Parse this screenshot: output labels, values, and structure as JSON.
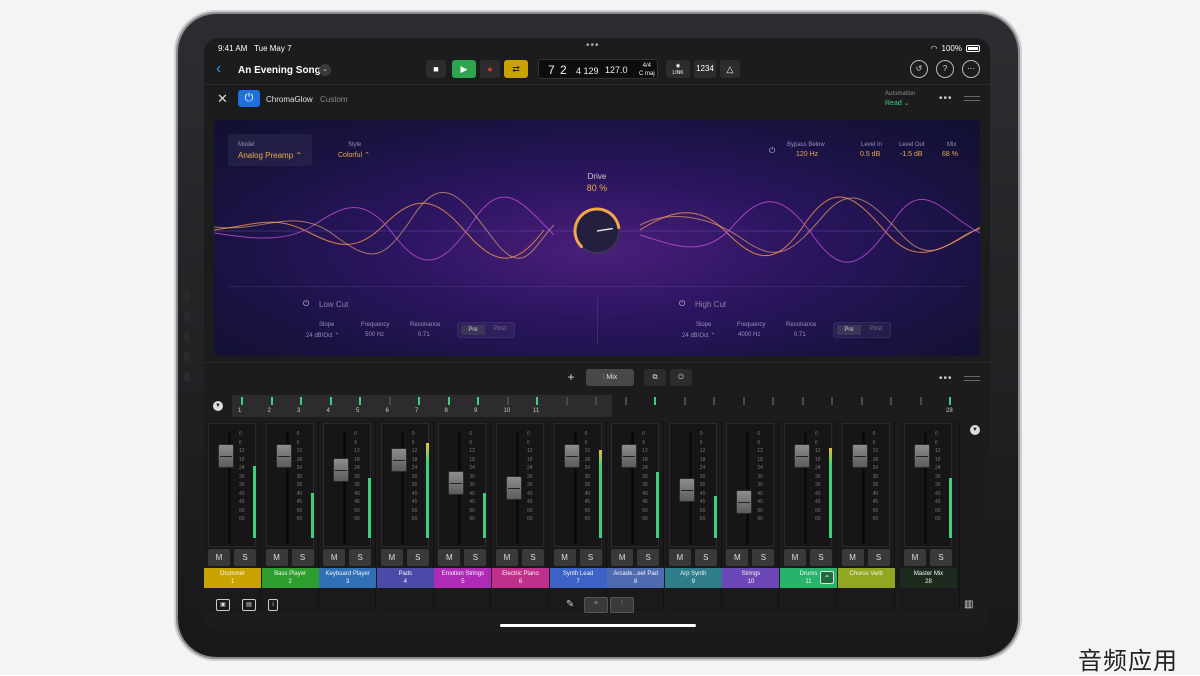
{
  "status": {
    "time": "9:41 AM",
    "date": "Tue May 7",
    "battery": "100%"
  },
  "toolbar": {
    "song_title": "An Evening Song",
    "lcd": {
      "bar": "7 2",
      "tick": "4 129",
      "tempo": "127.0",
      "time_sig": "4/4",
      "key": "C maj"
    },
    "link_label": "LINK",
    "count_in": "1234"
  },
  "plugin_header": {
    "name": "ChromaGlow",
    "preset": "Custom",
    "automation_label": "Automation",
    "automation_value": "Read"
  },
  "plugin": {
    "model": {
      "label": "Model",
      "value": "Analog Preamp"
    },
    "style": {
      "label": "Style",
      "value": "Colorful"
    },
    "bypass_below": {
      "label": "Bypass Below",
      "value": "120 Hz"
    },
    "level_in": {
      "label": "Level In",
      "value": "0.5 dB"
    },
    "level_out": {
      "label": "Level Out",
      "value": "-1.5 dB"
    },
    "mix": {
      "label": "Mix",
      "value": "68 %"
    },
    "drive": {
      "label": "Drive",
      "value": "80 %",
      "fraction": 0.8
    },
    "low_cut": {
      "title": "Low Cut",
      "slope_label": "Slope",
      "slope": "24 dB/Oct",
      "freq_label": "Frequency",
      "freq": "500 Hz",
      "res_label": "Resonance",
      "res": "0.71",
      "pre": "Pre",
      "post": "Post"
    },
    "high_cut": {
      "title": "High Cut",
      "slope_label": "Slope",
      "slope": "24 dB/Oct",
      "freq_label": "Frequency",
      "freq": "4000 Hz",
      "res_label": "Resonance",
      "res": "0.71",
      "pre": "Pre",
      "post": "Post"
    }
  },
  "mixer_toolbar": {
    "mix_label": "Mix"
  },
  "meter_numbers": [
    "1",
    "2",
    "3",
    "4",
    "5",
    "6",
    "7",
    "8",
    "9",
    "10",
    "11"
  ],
  "master_meter_number": "28",
  "scale": [
    "0",
    "6",
    "12",
    "18",
    "24",
    "30",
    "35",
    "40",
    "45",
    "50",
    "60"
  ],
  "mute": "M",
  "solo": "S",
  "channels": [
    {
      "name": "Drummer",
      "num": "1",
      "color": "#c9a400",
      "fader": 0.85,
      "level": 0.72
    },
    {
      "name": "Bass Player",
      "num": "2",
      "color": "#2e9e2e",
      "fader": 0.85,
      "level": 0.45
    },
    {
      "name": "Keyboard Player",
      "num": "3",
      "color": "#2f6fb5",
      "fader": 0.7,
      "level": 0.6
    },
    {
      "name": "Pads",
      "num": "4",
      "color": "#4a4aa8",
      "fader": 0.8,
      "level": 0.95
    },
    {
      "name": "Emotion Strings",
      "num": "5",
      "color": "#b02ab8",
      "fader": 0.55,
      "level": 0.45
    },
    {
      "name": "Electric Piano",
      "num": "6",
      "color": "#c0308a",
      "fader": 0.5,
      "level": 0.0
    },
    {
      "name": "Synth Lead",
      "num": "7",
      "color": "#3b62c4",
      "fader": 0.85,
      "level": 0.88
    },
    {
      "name": "Arcade...eet Pad",
      "num": "8",
      "color": "#4e6ab0",
      "fader": 0.85,
      "level": 0.66
    },
    {
      "name": "Arp Synth",
      "num": "9",
      "color": "#2d7d8a",
      "fader": 0.48,
      "level": 0.42
    },
    {
      "name": "Strings",
      "num": "10",
      "color": "#6b47b8",
      "fader": 0.35,
      "level": 0.0
    },
    {
      "name": "Drums",
      "num": "11",
      "color": "#27b36a",
      "fader": 0.85,
      "level": 0.9
    },
    {
      "name": "Chorus Verb",
      "num": "",
      "color": "#8fa820",
      "fader": 0.85,
      "level": 0.0
    }
  ],
  "master": {
    "name": "Master Mix",
    "num": "28",
    "color": "#1f2a1f",
    "fader": 0.85,
    "level": 0.6
  },
  "watermark": "音频应用"
}
